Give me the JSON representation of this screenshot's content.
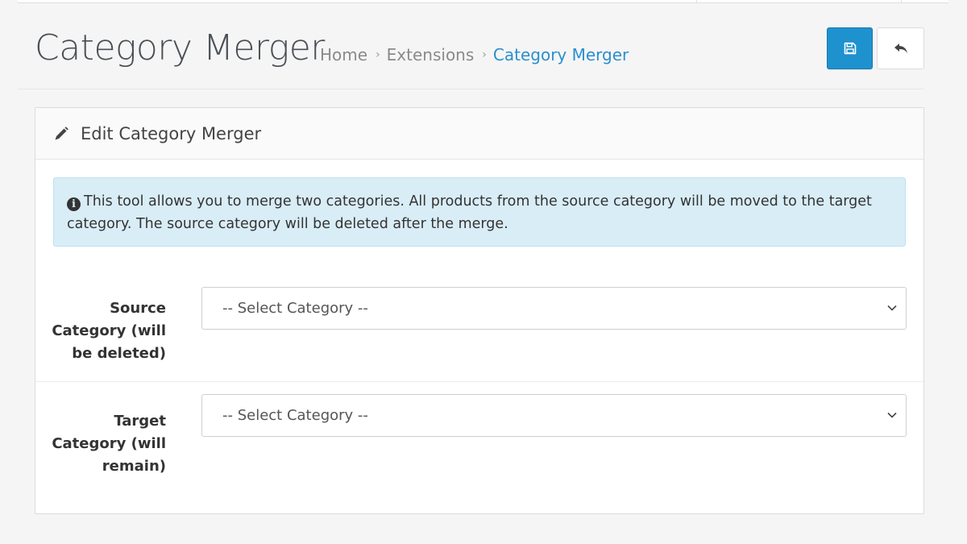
{
  "header": {
    "title": "Category Merger",
    "breadcrumb": [
      {
        "label": "Home",
        "active": false
      },
      {
        "label": "Extensions",
        "active": false
      },
      {
        "label": "Category Merger",
        "active": true
      }
    ],
    "separator": "›",
    "buttons": {
      "save_icon": "save-icon",
      "back_icon": "reply-icon"
    }
  },
  "panel": {
    "title": "Edit Category Merger",
    "title_icon": "pencil-icon",
    "alert": {
      "icon": "info-circle-icon",
      "text": "This tool allows you to merge two categories. All products from the source category will be moved to the target category. The source category will be deleted after the merge."
    },
    "fields": [
      {
        "label": "Source Category (will be deleted)",
        "selected": "-- Select Category --"
      },
      {
        "label": "Target Category (will remain)",
        "selected": "-- Select Category --"
      }
    ]
  },
  "colors": {
    "primary": "#1e91cf",
    "link_active": "#2a8fcf",
    "alert_bg": "#d9edf7"
  }
}
